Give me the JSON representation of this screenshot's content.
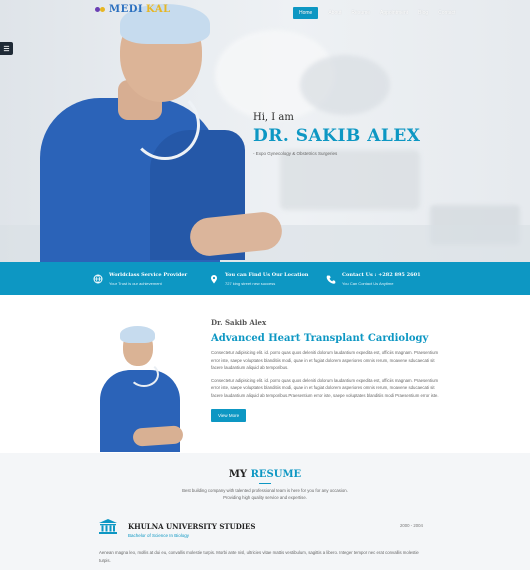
{
  "brand": {
    "logo_text_main": "MEDI",
    "logo_text_accent": "KAL",
    "colors": {
      "primary": "#0d97c3",
      "logo_blue": "#2a6fbf",
      "logo_gold": "#e7b623"
    }
  },
  "nav": {
    "items": [
      {
        "label": "Home",
        "active": true
      },
      {
        "label": "About"
      },
      {
        "label": "Resume"
      },
      {
        "label": "Appointment"
      },
      {
        "label": "Blog"
      },
      {
        "label": "Contact"
      }
    ]
  },
  "hero": {
    "greeting": "Hi, I am",
    "name": "DR. SAKIB ALEX",
    "tagline": "- Expo Gynecology & Obstetrics Surgeries"
  },
  "infobar": [
    {
      "icon": "globe-icon",
      "title": "Worldclass Service Provider",
      "subtitle": "Your Trust is our achievement"
    },
    {
      "icon": "location-pin-icon",
      "title": "You can Find Us Our Location",
      "subtitle": "727 king street new success"
    },
    {
      "icon": "phone-icon",
      "title": "Contact Us : +282 895 2601",
      "subtitle": "You Can Contact Us Anytime"
    }
  ],
  "about": {
    "who": "Dr. Sakib Alex",
    "headline": "Advanced Heart Transplant Cardiology",
    "para1": "Consectetur adipisicing elit. id. porro quas quos deleniti dolorum laudantium expedita est, officiis magnam. Praesentium error iste, saepe voluptates blanditiis modi, quae in et fugiat dolorem asperiores omnis rerum, moavene sducaecati sit facere laudantium aliquid ab temporibus.",
    "para2": "Consectetur adipisicing elit. id. porro quas quos deleniti dolorum laudantium expedita est, officiis magnam. Praesentium error iste, saepe voluptates blanditiis modi, quae in et fugiat dolorem asperiores omnis rerum, moavene sducaecati sit facere laudantium aliquid ab temporibus.Praesentium error iste, saepe voluptates blanditiis modi Praesentium error iste.",
    "button": "View More"
  },
  "resume": {
    "title_a": "MY",
    "title_b": "RESUME",
    "subtitle": "Best building company with talented professional team is here for you for any occasion. Providing high quality service and expertise.",
    "entries": [
      {
        "title": "KHULNA UNIVERSITY STUDIES",
        "degree": "Bachelor of Science In Biology",
        "years": "2000 - 2004",
        "description": "Aenean magna leo, mollis at dui eu, convallis molestie turpis. Morbi ante nisl, ultricies vitae mattis vestibulum, sagittis a libero. Integer tempor nec erat convallis molestie turpis."
      }
    ]
  }
}
